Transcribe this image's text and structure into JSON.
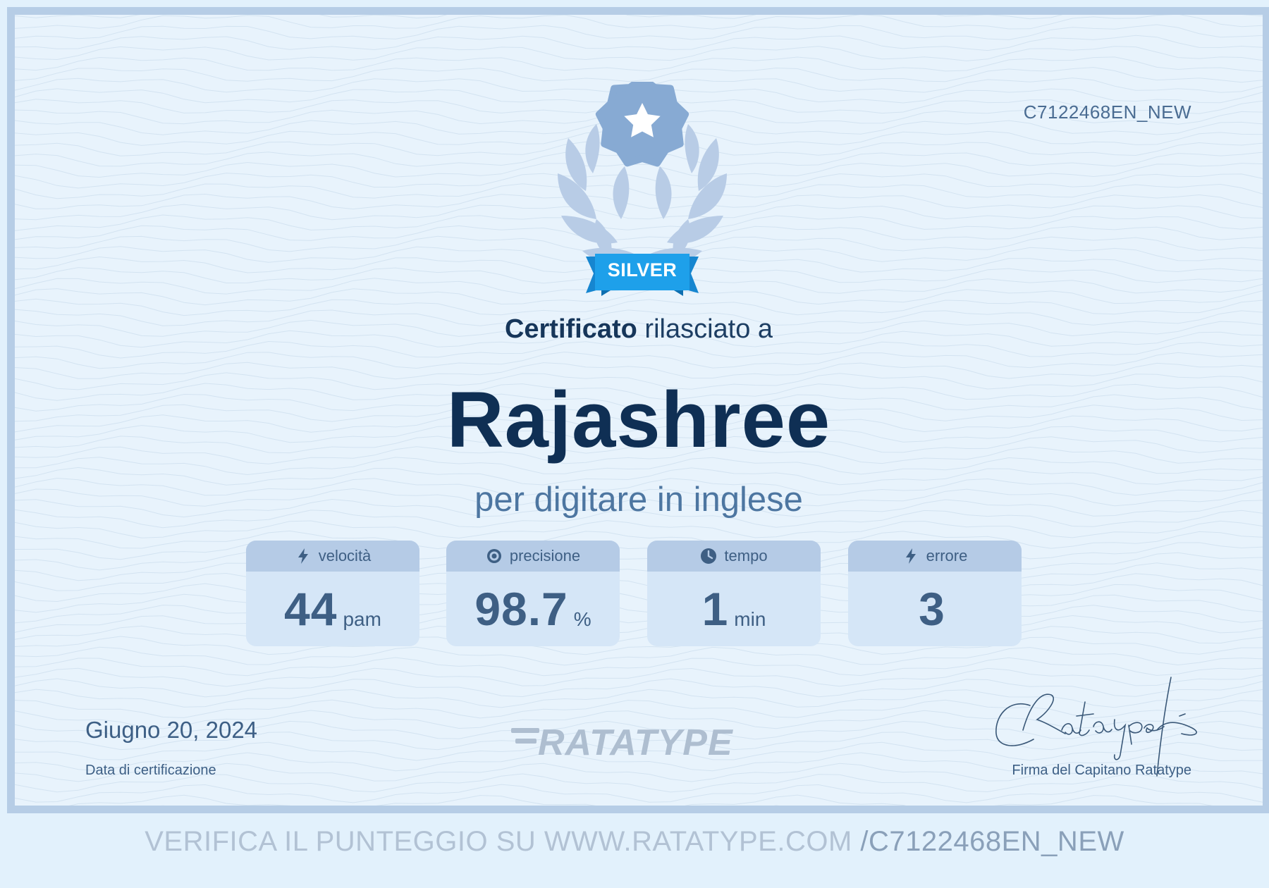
{
  "certificate": {
    "id": "C7122468EN_NEW",
    "badge": "SILVER",
    "issued_bold": "Certificato",
    "issued_rest": " rilasciato a",
    "name": "Rajashree",
    "subject": "per digitare in inglese"
  },
  "stats": [
    {
      "label": "velocità",
      "icon": "lightning-icon",
      "value": "44",
      "unit": "pam"
    },
    {
      "label": "precisione",
      "icon": "target-icon",
      "value": "98.7",
      "unit": "%"
    },
    {
      "label": "tempo",
      "icon": "clock-icon",
      "value": "1",
      "unit": "min"
    },
    {
      "label": "errore",
      "icon": "lightning-icon",
      "value": "3",
      "unit": ""
    }
  ],
  "footer": {
    "date": "Giugno 20, 2024",
    "date_label": "Data di certificazione",
    "logo": "RATATYPE",
    "signature_label": "Firma del Capitano Ratatype"
  },
  "verify": {
    "prefix": "VERIFICA IL PUNTEGGIO SU WWW.RATATYPE.COM ",
    "code": "/C7122468EN_NEW"
  },
  "colors": {
    "badge_ribbon": "#1ea0ea",
    "star_badge": "#87aad3",
    "laurel": "#b8cce6",
    "name_text": "#0f2f54",
    "frame_border": "#b6cde6"
  }
}
